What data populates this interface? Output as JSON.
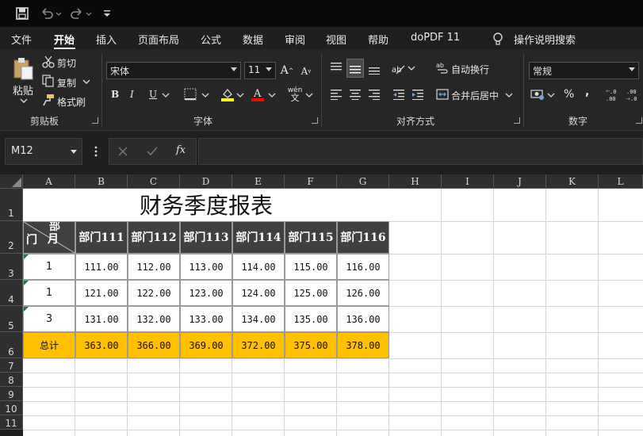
{
  "menu": [
    "文件",
    "开始",
    "插入",
    "页面布局",
    "公式",
    "数据",
    "审阅",
    "视图",
    "帮助",
    "doPDF 11"
  ],
  "menu_active": "开始",
  "tell_me": "操作说明搜索",
  "clipboard": {
    "paste": "粘贴",
    "cut": "剪切",
    "copy": "复制",
    "format_painter": "格式刷",
    "label": "剪贴板"
  },
  "font": {
    "name": "宋体",
    "size": "11",
    "label": "字体",
    "bold": "B",
    "italic": "I",
    "underline": "U",
    "phonetic": "wén"
  },
  "alignment": {
    "wrap": "自动换行",
    "merge": "合并后居中",
    "label": "对齐方式"
  },
  "number": {
    "format": "常规",
    "label": "数字",
    "percent": "%",
    "comma": ","
  },
  "formula_bar": {
    "name_box": "M12",
    "fx": "fx",
    "value": ""
  },
  "columns": [
    "A",
    "B",
    "C",
    "D",
    "E",
    "F",
    "G",
    "H",
    "I",
    "J",
    "K",
    "L"
  ],
  "rows": [
    "1",
    "2",
    "3",
    "4",
    "5",
    "6",
    "7",
    "8",
    "9",
    "10",
    "11"
  ],
  "sheet": {
    "title": "财务季度报表",
    "corner_top": "部",
    "corner_top2": "月",
    "corner_bottom": "门",
    "headers": [
      "部门111",
      "部门112",
      "部门113",
      "部门114",
      "部门115",
      "部门116"
    ],
    "rows": [
      {
        "label": "1",
        "values": [
          "111.00",
          "112.00",
          "113.00",
          "114.00",
          "115.00",
          "116.00"
        ]
      },
      {
        "label": "1",
        "values": [
          "121.00",
          "122.00",
          "123.00",
          "124.00",
          "125.00",
          "126.00"
        ]
      },
      {
        "label": "3",
        "values": [
          "131.00",
          "132.00",
          "133.00",
          "134.00",
          "135.00",
          "136.00"
        ]
      }
    ],
    "total": {
      "label": "总计",
      "values": [
        "363.00",
        "366.00",
        "369.00",
        "372.00",
        "375.00",
        "378.00"
      ]
    }
  },
  "colors": {
    "total_fill": "#ffc000",
    "header_fill": "#404040"
  }
}
